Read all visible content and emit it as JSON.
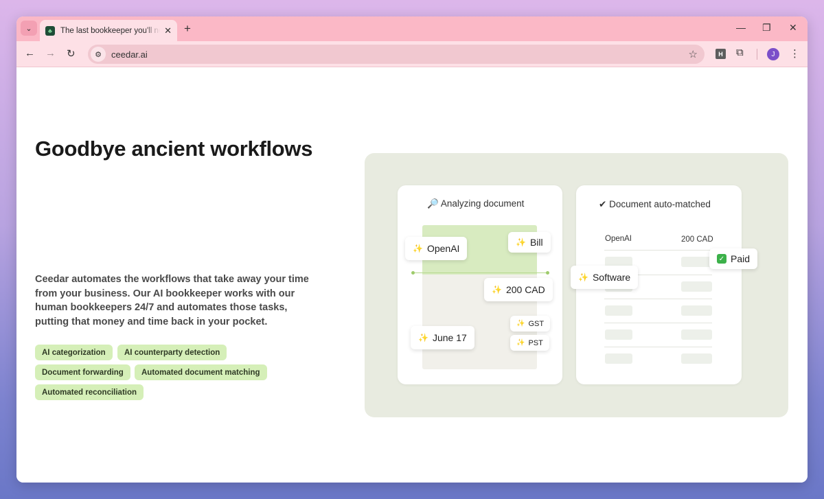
{
  "browser": {
    "tab": {
      "title": "The last bookkeeper you'll need",
      "favicon_color": "#1e4d37"
    },
    "url": "ceedar.ai",
    "profile_initial": "J",
    "extension_label": "H",
    "colors": {
      "tabstrip": "#fbb8c6",
      "toolbar": "#fde0e6",
      "omnibox": "#f1c8d0",
      "avatar": "#7b4fc9"
    }
  },
  "hero": {
    "title": "Goodbye ancient workflows",
    "description": "Ceedar automates the workflows that take away your time from your business. Our AI bookkeeper works with our human bookkeepers 24/7 and automates those tasks, putting that money and time back in your pocket.",
    "tags": [
      "AI categorization",
      "AI counterparty detection",
      "Document forwarding",
      "Automated document matching",
      "Automated reconciliation"
    ],
    "tag_color": "#d5efb8"
  },
  "illustration": {
    "analyzing_card": {
      "title": "Analyzing document",
      "chips": {
        "vendor": "OpenAI",
        "type": "Bill",
        "amount": "200 CAD",
        "gst": "GST",
        "pst": "PST",
        "date": "June 17"
      }
    },
    "matched_card": {
      "title": "Document auto-matched",
      "head_vendor": "OpenAI",
      "head_amount": "200 CAD",
      "category_chip": "Software",
      "status_chip": "Paid"
    },
    "panel_color": "#e8ebe0"
  }
}
